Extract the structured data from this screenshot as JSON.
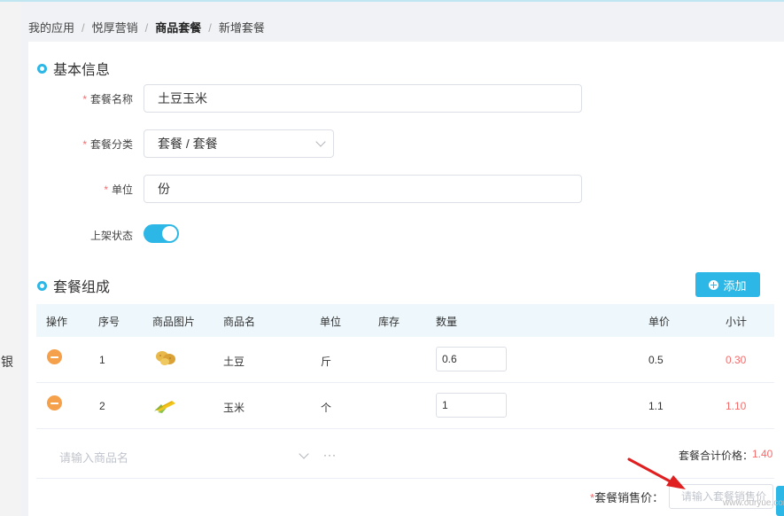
{
  "sidebar": {
    "partial_text": "银"
  },
  "breadcrumb": [
    "我的应用",
    "悦厚营销",
    "商品套餐",
    "新增套餐"
  ],
  "basic_info": {
    "title": "基本信息",
    "name_label": "套餐名称",
    "name_value": "土豆玉米",
    "category_label": "套餐分类",
    "category_value": "套餐 / 套餐",
    "unit_label": "单位",
    "unit_value": "份",
    "status_label": "上架状态",
    "status_on": true
  },
  "composition": {
    "title": "套餐组成",
    "add_button": "添加",
    "columns": [
      "操作",
      "序号",
      "商品图片",
      "商品名",
      "单位",
      "库存",
      "数量",
      "单价",
      "小计"
    ],
    "rows": [
      {
        "index": "1",
        "image": "potato-image",
        "name": "土豆",
        "unit": "斤",
        "stock": "",
        "qty": "0.6",
        "price": "0.5",
        "subtotal": "0.30"
      },
      {
        "index": "2",
        "image": "corn-image",
        "name": "玉米",
        "unit": "个",
        "stock": "",
        "qty": "1",
        "price": "1.1",
        "subtotal": "1.10"
      }
    ],
    "search_placeholder": "请输入商品名",
    "more": "···",
    "total_label": "套餐合计价格：",
    "total_value": "1.40"
  },
  "sale": {
    "label": "套餐销售价：",
    "placeholder": "请输入套餐销售价"
  },
  "watermark": "www.ouryue.com",
  "colors": {
    "accent": "#2db7e6",
    "danger": "#f56c6c",
    "minus": "#f5a04b"
  }
}
